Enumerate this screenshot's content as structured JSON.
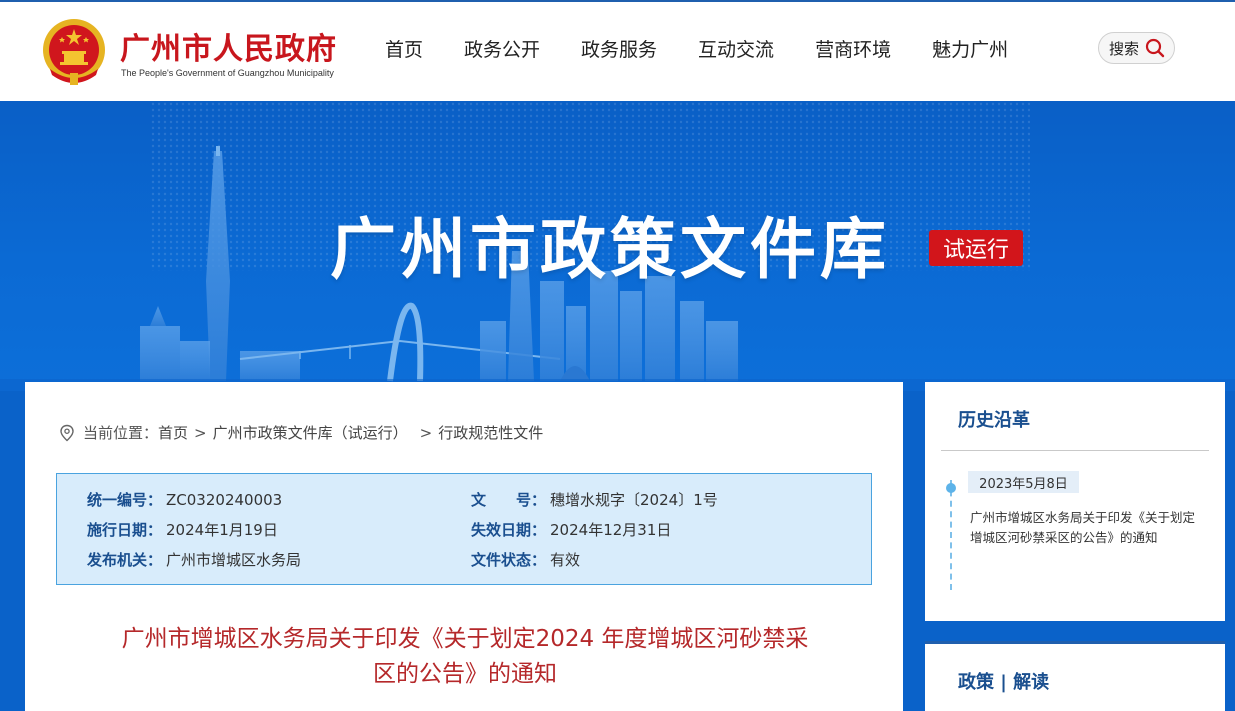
{
  "header": {
    "site_title": "广州市人民政府",
    "site_subtitle": "The People's Government of Guangzhou Municipality",
    "nav": [
      {
        "label": "首页"
      },
      {
        "label": "政务公开"
      },
      {
        "label": "政务服务"
      },
      {
        "label": "互动交流"
      },
      {
        "label": "营商环境"
      },
      {
        "label": "魅力广州"
      }
    ],
    "search_label": "搜索"
  },
  "banner": {
    "title": "广州市政策文件库",
    "badge": "试运行"
  },
  "breadcrumb": {
    "prefix": "当前位置：",
    "items": [
      "首页",
      "广州市政策文件库（试运行）",
      "行政规范性文件"
    ],
    "separator": ">"
  },
  "info": {
    "serial_label": "统一编号：",
    "serial_value": "ZC0320240003",
    "docno_label": "文　　号：",
    "docno_value": "穗增水规字〔2024〕1号",
    "effective_label": "施行日期：",
    "effective_value": "2024年1月19日",
    "expiry_label": "失效日期：",
    "expiry_value": "2024年12月31日",
    "issuer_label": "发布机关：",
    "issuer_value": "广州市增城区水务局",
    "status_label": "文件状态：",
    "status_value": "有效"
  },
  "document": {
    "title_line1": "广州市增城区水务局关于印发《关于划定2024 年度增城区河砂禁采",
    "title_line2": "区的公告》的通知"
  },
  "history": {
    "title": "历史沿革",
    "items": [
      {
        "date": "2023年5月8日",
        "text": "广州市增城区水务局关于印发《关于划定增城区河砂禁采区的公告》的通知"
      }
    ]
  },
  "policy": {
    "title": "政策 | 解读"
  },
  "colors": {
    "brand_red": "#c8161d",
    "banner_blue": "#0a62c9",
    "label_blue": "#1a4f8f",
    "title_red": "#b5282a"
  }
}
